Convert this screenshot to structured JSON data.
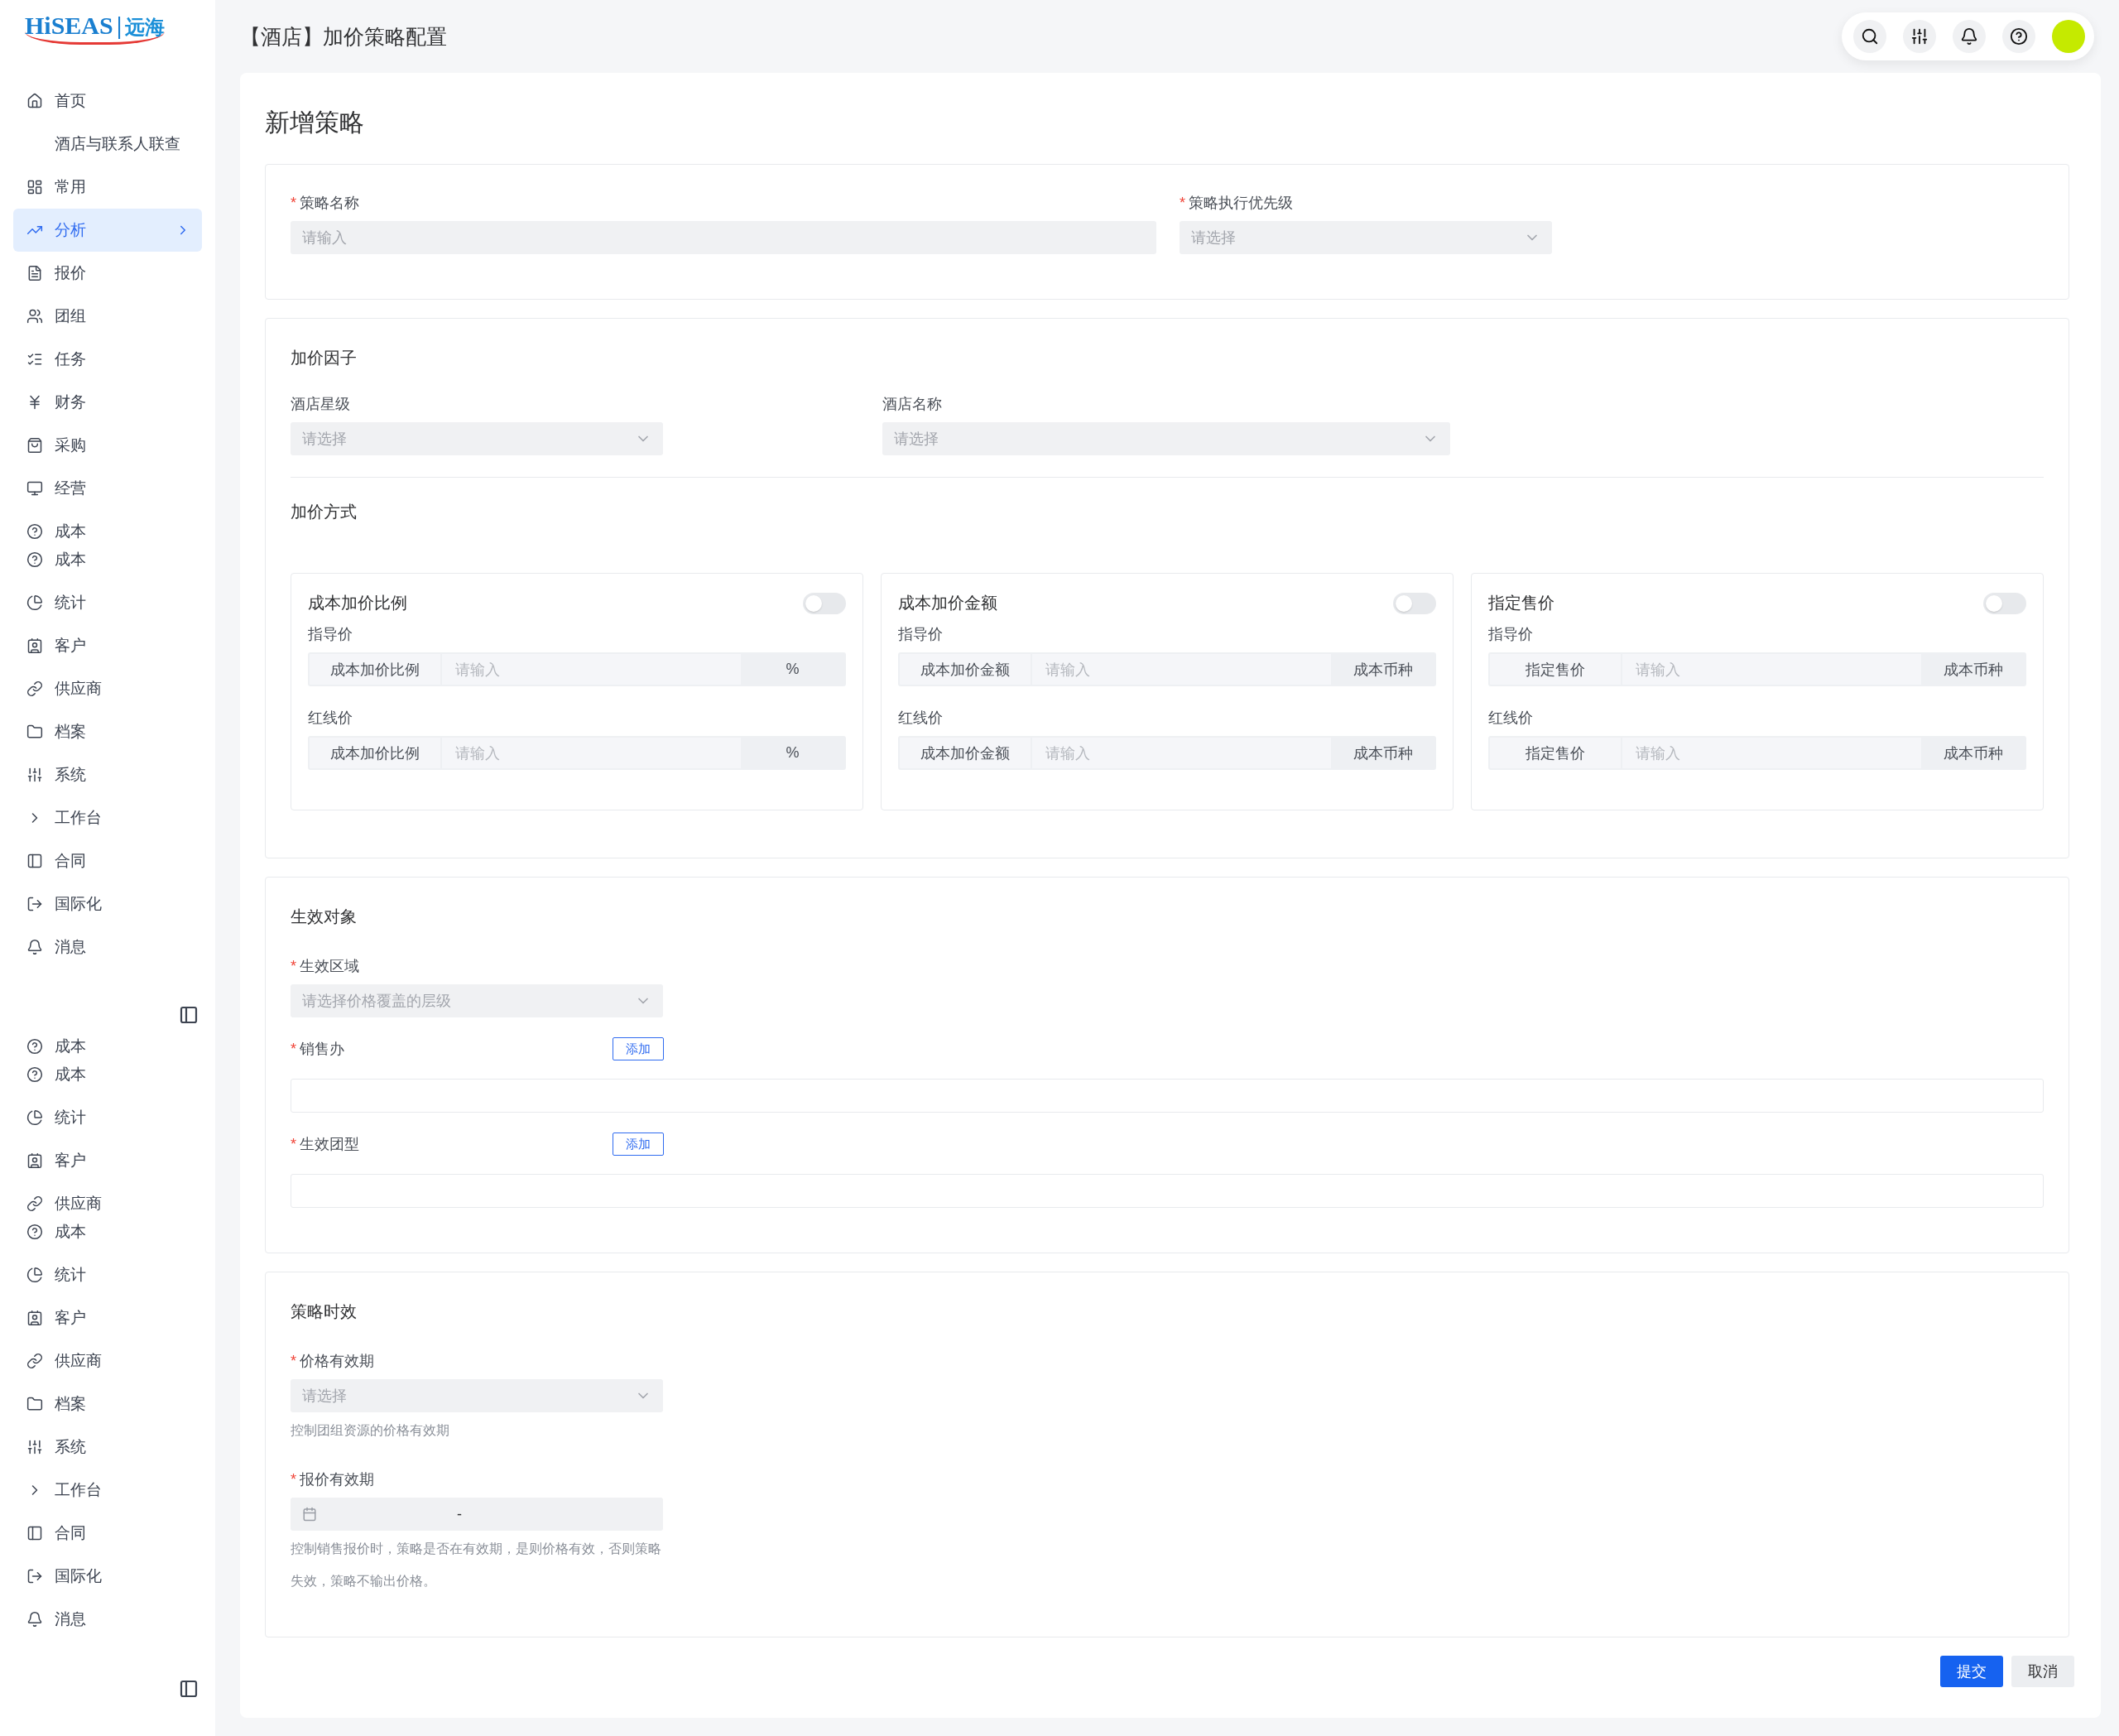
{
  "logo": {
    "brand": "HiSEAS",
    "divider": "|",
    "name": "远海"
  },
  "sidebar": {
    "blocks": [
      {
        "groups": [
          {
            "items": [
              {
                "label": "首页",
                "kind": "home",
                "selected": false
              }
            ]
          },
          {
            "items": [
              {
                "label": "酒店与联系人联查",
                "kind": "plain",
                "selected": false
              }
            ]
          },
          {
            "items": [
              {
                "label": "常用",
                "kind": "grid",
                "selected": false
              }
            ]
          },
          {
            "items": [
              {
                "label": "分析",
                "kind": "chart",
                "selected": true
              }
            ]
          },
          {
            "items": [
              {
                "label": "报价",
                "kind": "doc",
                "selected": false
              }
            ]
          },
          {
            "items": [
              {
                "label": "团组",
                "kind": "users",
                "selected": false
              }
            ]
          },
          {
            "items": [
              {
                "label": "任务",
                "kind": "list",
                "selected": false
              }
            ]
          },
          {
            "items": [
              {
                "label": "财务",
                "kind": "yen",
                "selected": false
              }
            ]
          },
          {
            "items": [
              {
                "label": "采购",
                "kind": "bag",
                "selected": false
              }
            ]
          },
          {
            "items": [
              {
                "label": "经营",
                "kind": "monitor",
                "selected": false
              }
            ]
          },
          {
            "items": [
              {
                "label": "成本",
                "kind": "help",
                "selected": false
              },
              {
                "label": "成本",
                "kind": "help",
                "selected": false
              }
            ]
          },
          {
            "items": [
              {
                "label": "统计",
                "kind": "pie",
                "selected": false
              }
            ]
          },
          {
            "items": [
              {
                "label": "客户",
                "kind": "contact",
                "selected": false
              }
            ]
          },
          {
            "items": [
              {
                "label": "供应商",
                "kind": "link",
                "selected": false
              }
            ]
          },
          {
            "items": [
              {
                "label": "档案",
                "kind": "folder",
                "selected": false
              }
            ]
          },
          {
            "items": [
              {
                "label": "系统",
                "kind": "sliders",
                "selected": false
              }
            ]
          },
          {
            "items": [
              {
                "label": "工作台",
                "kind": "chevron",
                "selected": false
              }
            ]
          },
          {
            "items": [
              {
                "label": "合同",
                "kind": "panel",
                "selected": false
              }
            ]
          },
          {
            "items": [
              {
                "label": "国际化",
                "kind": "logout",
                "selected": false
              }
            ]
          },
          {
            "items": [
              {
                "label": "消息",
                "kind": "bell",
                "selected": false
              }
            ]
          }
        ]
      },
      {
        "groups": [
          {
            "items": [
              {
                "label": "成本",
                "kind": "help",
                "selected": false
              },
              {
                "label": "成本",
                "kind": "help",
                "selected": false
              }
            ]
          },
          {
            "items": [
              {
                "label": "统计",
                "kind": "pie",
                "selected": false
              }
            ]
          },
          {
            "items": [
              {
                "label": "客户",
                "kind": "contact",
                "selected": false
              }
            ]
          },
          {
            "items": [
              {
                "label": "供应商",
                "kind": "link",
                "selected": false
              },
              {
                "label": "成本",
                "kind": "help",
                "selected": false
              }
            ]
          },
          {
            "items": [
              {
                "label": "统计",
                "kind": "pie",
                "selected": false
              }
            ]
          },
          {
            "items": [
              {
                "label": "客户",
                "kind": "contact",
                "selected": false
              }
            ]
          },
          {
            "items": [
              {
                "label": "供应商",
                "kind": "link",
                "selected": false
              }
            ]
          },
          {
            "items": [
              {
                "label": "档案",
                "kind": "folder",
                "selected": false
              }
            ]
          },
          {
            "items": [
              {
                "label": "系统",
                "kind": "sliders",
                "selected": false
              }
            ]
          },
          {
            "items": [
              {
                "label": "工作台",
                "kind": "chevron",
                "selected": false
              }
            ]
          },
          {
            "items": [
              {
                "label": "合同",
                "kind": "panel",
                "selected": false
              }
            ]
          },
          {
            "items": [
              {
                "label": "国际化",
                "kind": "logout",
                "selected": false
              }
            ]
          },
          {
            "items": [
              {
                "label": "消息",
                "kind": "bell",
                "selected": false
              }
            ]
          }
        ]
      }
    ]
  },
  "header": {
    "title": "【酒店】加价策略配置"
  },
  "page": {
    "title": "新增策略"
  },
  "basic": {
    "fields": [
      {
        "label": "策略名称",
        "marker": "*",
        "kind": "input",
        "placeholder": "请输入"
      },
      {
        "label": "策略执行优先级",
        "marker": "*",
        "kind": "select",
        "placeholder": "请选择"
      }
    ]
  },
  "factors": {
    "heading": "加价因子",
    "fields": [
      {
        "label": "酒店星级",
        "kind": "select",
        "placeholder": "请选择"
      },
      {
        "label": "酒店名称",
        "kind": "select",
        "placeholder": "请选择"
      }
    ]
  },
  "method": {
    "heading": "加价方式",
    "cards": [
      {
        "title": "成本加价比例",
        "on": false,
        "rows": [
          {
            "label": "指导价",
            "prefix": "成本加价比例",
            "placeholder": "请输入",
            "suffix": "%"
          },
          {
            "label": "红线价",
            "prefix": "成本加价比例",
            "placeholder": "请输入",
            "suffix": "%"
          }
        ]
      },
      {
        "title": "成本加价金额",
        "on": false,
        "rows": [
          {
            "label": "指导价",
            "prefix": "成本加价金额",
            "placeholder": "请输入",
            "suffix": "成本币种"
          },
          {
            "label": "红线价",
            "prefix": "成本加价金额",
            "placeholder": "请输入",
            "suffix": "成本币种"
          }
        ]
      },
      {
        "title": "指定售价",
        "on": false,
        "rows": [
          {
            "label": "指导价",
            "prefix": "指定售价",
            "placeholder": "请输入",
            "suffix": "成本币种"
          },
          {
            "label": "红线价",
            "prefix": "指定售价",
            "placeholder": "请输入",
            "suffix": "成本币种"
          }
        ]
      }
    ]
  },
  "targets": {
    "heading": "生效对象",
    "fields": [
      {
        "label": "生效区域",
        "marker": "*",
        "kind": "select",
        "placeholder": "请选择价格覆盖的层级"
      },
      {
        "label": "销售办",
        "marker": "*",
        "kind": "list",
        "button": "添加"
      },
      {
        "label": "生效团型",
        "marker": "*",
        "kind": "list",
        "button": "添加"
      }
    ]
  },
  "validity": {
    "heading": "策略时效",
    "fields": [
      {
        "label": "价格有效期",
        "marker": "*",
        "kind": "select",
        "placeholder": "请选择",
        "help": "控制团组资源的价格有效期"
      },
      {
        "label": "报价有效期",
        "marker": "*",
        "kind": "daterange",
        "separator": "-",
        "help": "控制销售报价时，策略是否在有效期，是则价格有效，否则策略失效，策略不输出价格。"
      }
    ]
  },
  "actions": [
    {
      "label": "提交",
      "kind": "primary"
    },
    {
      "label": "取消",
      "kind": "default"
    }
  ]
}
